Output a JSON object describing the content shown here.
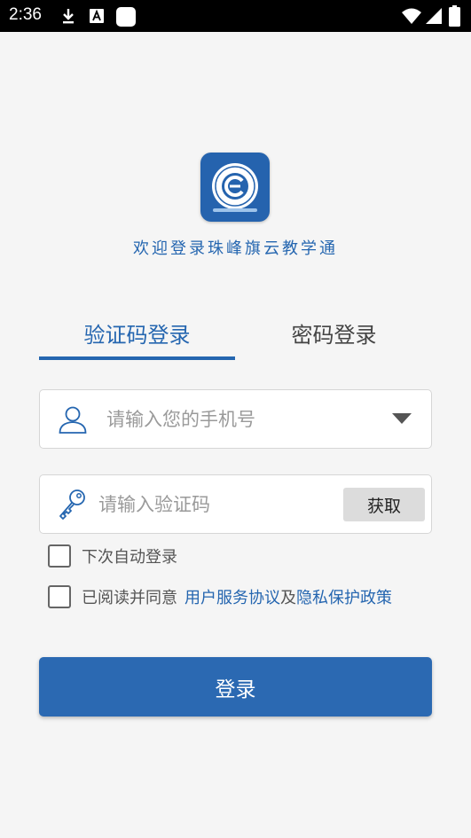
{
  "status_bar": {
    "time": "2:36",
    "icons": [
      "download-icon",
      "a-icon",
      "app-icon",
      "wifi-icon",
      "signal-icon",
      "battery-icon"
    ]
  },
  "app": {
    "welcome": "欢迎登录珠峰旗云教学通",
    "logo_icon": "school-logo-icon"
  },
  "tabs": [
    {
      "label": "验证码登录",
      "active": true
    },
    {
      "label": "密码登录",
      "active": false
    }
  ],
  "phone": {
    "placeholder": "请输入您的手机号",
    "value": ""
  },
  "code": {
    "placeholder": "请输入验证码",
    "value": "",
    "get_label": "获取"
  },
  "remember": {
    "label": "下次自动登录",
    "checked": false
  },
  "agreement": {
    "prefix": "已阅读并同意",
    "terms": "用户服务协议",
    "and": "及",
    "privacy": "隐私保护政策",
    "checked": false
  },
  "login": {
    "label": "登录"
  },
  "colors": {
    "accent": "#2566b0",
    "button": "#2b69b2",
    "background": "#f5f5f5"
  }
}
